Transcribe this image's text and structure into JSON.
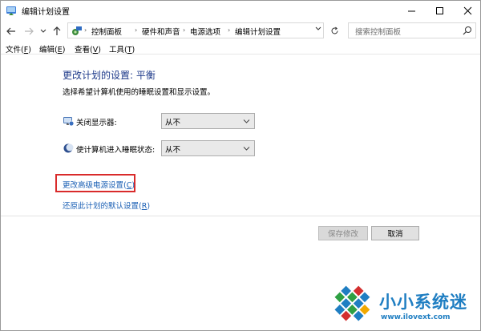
{
  "window": {
    "title": "编辑计划设置",
    "minimize_icon": "minimize-icon",
    "maximize_icon": "maximize-icon",
    "close_icon": "close-icon"
  },
  "navigation": {
    "back_icon": "back-arrow-icon",
    "forward_icon": "forward-arrow-icon",
    "recent_icon": "chevron-down-icon",
    "up_icon": "up-arrow-icon",
    "breadcrumbs": [
      "控制面板",
      "硬件和声音",
      "电源选项",
      "编辑计划设置"
    ],
    "refresh_icon": "refresh-icon",
    "search_placeholder": "搜索控制面板"
  },
  "menu": {
    "file": {
      "label": "文件(",
      "key": "F",
      "end": ")"
    },
    "edit": {
      "label": "编辑(",
      "key": "E",
      "end": ")"
    },
    "view": {
      "label": "查看(",
      "key": "V",
      "end": ")"
    },
    "tools": {
      "label": "工具(",
      "key": "T",
      "end": ")"
    }
  },
  "content": {
    "title": "更改计划的设置: 平衡",
    "description": "选择希望计算机使用的睡眠设置和显示设置。",
    "settings": [
      {
        "label": "关闭显示器:",
        "value": "从不",
        "icon": "monitor-icon"
      },
      {
        "label": "使计算机进入睡眠状态:",
        "value": "从不",
        "icon": "moon-icon"
      }
    ],
    "advanced_link": {
      "label": "更改高级电源设置(",
      "key": "C",
      "end": ")"
    },
    "restore_link": {
      "label": "还原此计划的默认设置(",
      "key": "R",
      "end": ")"
    },
    "save_button": "保存修改",
    "cancel_button": "取消"
  },
  "watermark": {
    "name": "小小系统迷",
    "url": "www.ilovext.com"
  },
  "colors": {
    "title_blue": "#1e3a8a",
    "link_blue": "#1a5fb4",
    "highlight_red": "#d92b2b",
    "watermark_blue": "#1f7ec2"
  }
}
